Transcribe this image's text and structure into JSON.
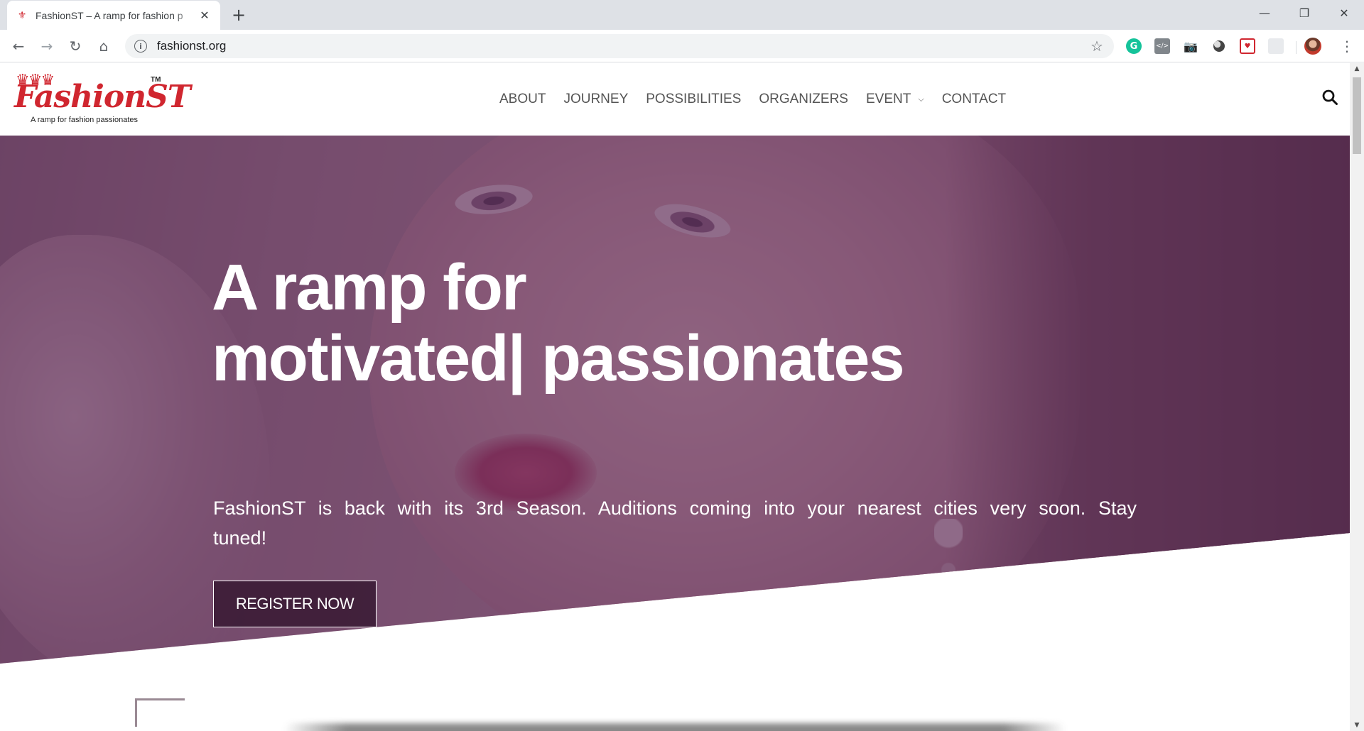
{
  "browser": {
    "tab_title": "FashionST – A ramp for fashion p",
    "tab_favicon": "fashionst-crown-favicon",
    "new_tab_label": "+",
    "url": "fashionst.org",
    "window_controls": {
      "minimize": "—",
      "restore": "❐",
      "close": "✕"
    },
    "nav_icons": {
      "back": "←",
      "forward": "→",
      "reload": "↻",
      "home": "⌂"
    },
    "extensions": [
      "grammarly-icon",
      "code-view-icon",
      "screenshot-camera-icon",
      "circle-extension-icon",
      "pocket-icon",
      "blank-extension-icon"
    ]
  },
  "site": {
    "logo": {
      "brand": "FashionST",
      "tm": "TM",
      "tagline": "A ramp for fashion passionates",
      "crown": "♛♛♛"
    },
    "nav": [
      {
        "label": "ABOUT"
      },
      {
        "label": "JOURNEY"
      },
      {
        "label": "POSSIBILITIES"
      },
      {
        "label": "ORGANIZERS"
      },
      {
        "label": "EVENT",
        "dropdown": true
      },
      {
        "label": "CONTACT"
      }
    ],
    "search_icon": "search-icon"
  },
  "hero": {
    "title_line1": "A ramp for",
    "title_line2": "motivated| passionates",
    "subtitle": "FashionST is back with its 3rd Season. Auditions coming into your nearest cities very soon. Stay tuned!",
    "cta_label": "REGISTER NOW",
    "overlay_color": "#582654"
  },
  "colors": {
    "brand_red": "#d0262f",
    "nav_text": "#555555",
    "chrome_bg": "#dee1e6"
  }
}
